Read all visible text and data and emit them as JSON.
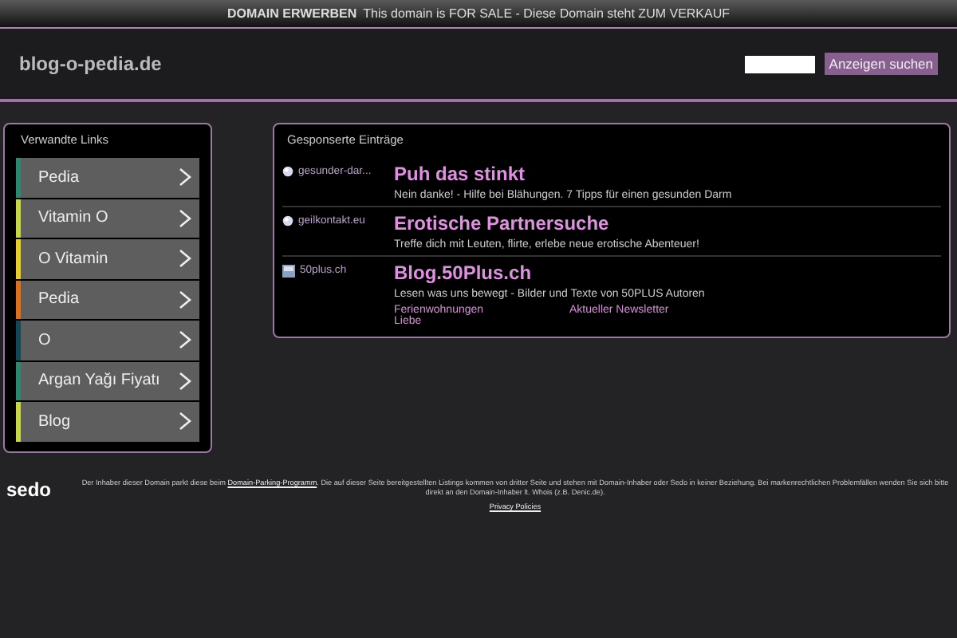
{
  "top_bar": {
    "label": "DOMAIN ERWERBEN",
    "text": "This domain is FOR SALE - Diese Domain steht ZUM VERKAUF"
  },
  "header": {
    "site_name": "blog-o-pedia.de",
    "search_button": "Anzeigen suchen"
  },
  "sidebar": {
    "title": "Verwandte Links",
    "items": [
      {
        "label": "Pedia",
        "color": "#2a8a70"
      },
      {
        "label": "Vitamin O",
        "color": "#c8d840"
      },
      {
        "label": "O Vitamin",
        "color": "#e8d020"
      },
      {
        "label": "Pedia",
        "color": "#e07018"
      },
      {
        "label": "O",
        "color": "#104858"
      },
      {
        "label": "Argan Yağı Fiyatı",
        "color": "#2a8a70"
      },
      {
        "label": "Blog",
        "color": "#c8d840"
      }
    ]
  },
  "ads": {
    "title": "Gesponserte Einträge",
    "items": [
      {
        "kind": "globe",
        "domain": "gesunder-dar...",
        "headline": "Puh das stinkt",
        "description": "Nein danke! - Hilfe bei Blähungen. 7 Tipps für einen gesunden Darm"
      },
      {
        "kind": "globe",
        "domain": "geilkontakt.eu",
        "headline": "Erotische Partnersuche",
        "description": "Treffe dich mit Leuten, flirte, erlebe neue erotische Abenteuer!"
      },
      {
        "kind": "favicon",
        "domain": "50plus.ch",
        "headline": "Blog.50Plus.ch",
        "description": "Lesen was uns bewegt - Bilder und Texte von 50PLUS Autoren",
        "sitelinks": [
          "Ferienwohnungen",
          "Aktueller Newsletter",
          "Liebe"
        ]
      }
    ]
  },
  "footer": {
    "logo": "sedo",
    "text_before": "Der Inhaber dieser Domain parkt diese beim ",
    "link": "Domain-Parking-Programm",
    "text_after": ". Die auf dieser Seite bereitgestellten Listings kommen von dritter Seite und stehen mit Domain-Inhaber oder Sedo in keiner Beziehung. Bei markenrechtlichen Problemfällen wenden Sie sich bitte direkt an den Domain-Inhaber lt. Whois (z.B. Denic.de).",
    "privacy": "Privacy Policies"
  }
}
